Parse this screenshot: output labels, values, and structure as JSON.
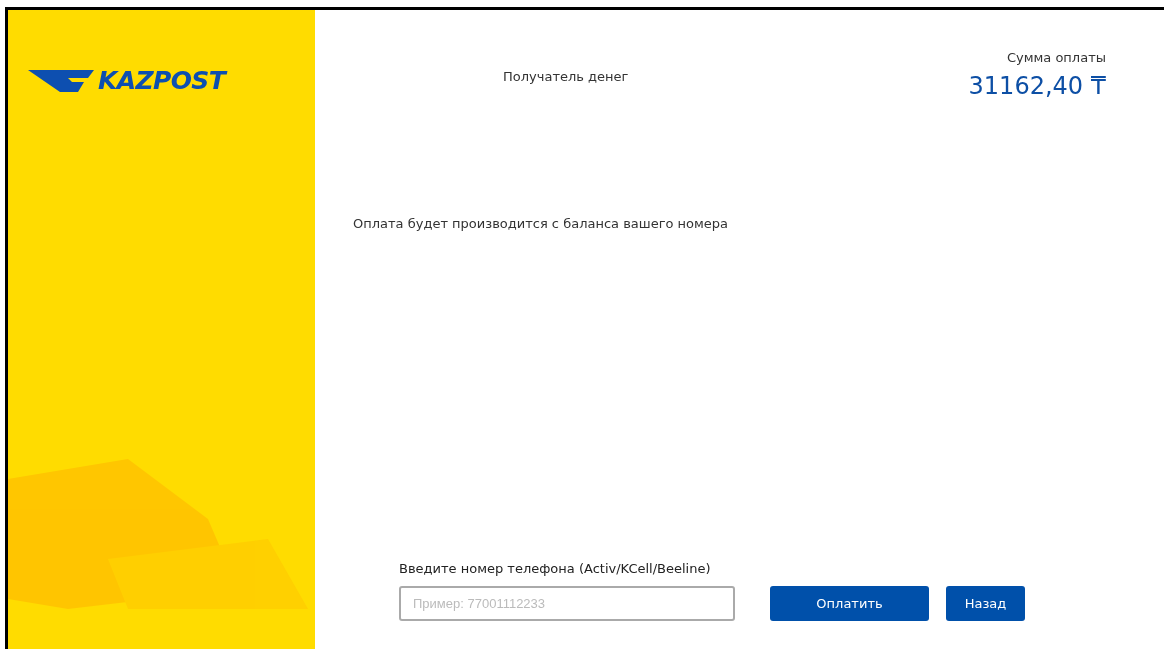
{
  "logo": {
    "text": "KAZPOST"
  },
  "header": {
    "recipient_label": "Получатель денег",
    "sum_label": "Сумма оплаты",
    "sum_value": "31162,40 ₸"
  },
  "message": "Оплата будет производится с баланса вашего номера",
  "phone": {
    "label": "Введите номер телефона (Activ/KCell/Beeline)",
    "placeholder": "Пример: 77001112233"
  },
  "buttons": [
    "Оплатить",
    "Назад"
  ]
}
